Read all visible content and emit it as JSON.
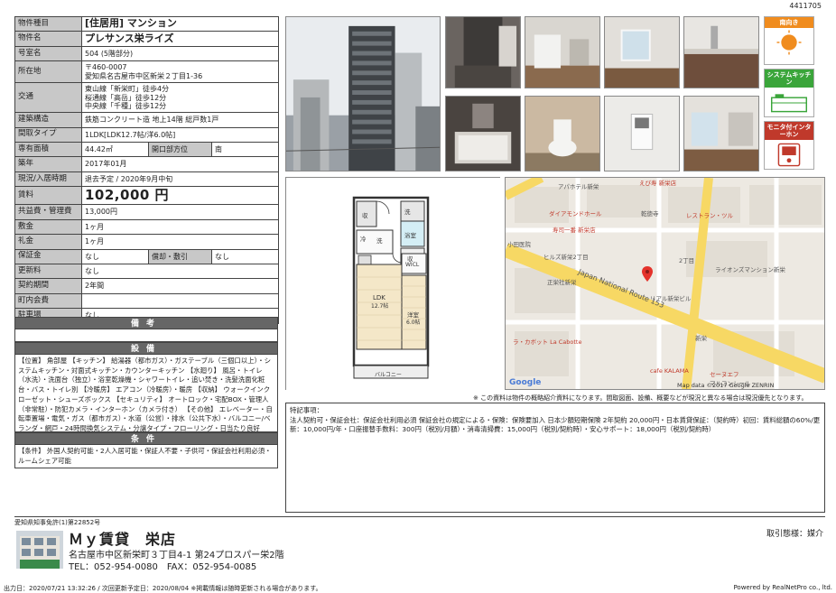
{
  "listing_id": "4411705",
  "spec": {
    "rows": [
      {
        "label": "物件種目",
        "value": "[住居用] マンション",
        "big": true
      },
      {
        "label": "物件名",
        "value": "プレサンス栄ライズ",
        "big": true
      },
      {
        "label": "号室名",
        "value": "504 (5階部分)"
      },
      {
        "label": "所在地",
        "lines": [
          "〒460-0007",
          "愛知県名古屋市中区新栄２丁目1-36"
        ]
      },
      {
        "label": "交通",
        "lines": [
          "東山線「新栄町」徒歩4分",
          "桜通線「高岳」徒歩12分",
          "中央線「千種」徒歩12分"
        ]
      },
      {
        "label": "建築構造",
        "value": "鉄筋コンクリート造 地上14階 総戸数1戸"
      },
      {
        "label": "間取タイプ",
        "value": "1LDK[LDK12.7帖/洋6.0帖]"
      },
      {
        "label": "専有面積",
        "value": "44.42㎡",
        "sub_label": "開口部方位",
        "sub_value": "南"
      },
      {
        "label": "築年",
        "value": "2017年01月"
      },
      {
        "label": "現況/入居時期",
        "value": "退去予定 / 2020年9月中旬"
      },
      {
        "label": "賃料",
        "value": "102,000 円",
        "rent": true
      },
      {
        "label": "共益費・管理費",
        "value": "13,000円"
      },
      {
        "label": "敷金",
        "value": "1ヶ月"
      },
      {
        "label": "礼金",
        "value": "1ヶ月"
      },
      {
        "label": "保証金",
        "value": "なし",
        "sub_label": "償却・敷引",
        "sub_value": "なし"
      },
      {
        "label": "更新料",
        "value": "なし"
      },
      {
        "label": "契約期間",
        "value": "2年間"
      },
      {
        "label": "町内会費",
        "value": ""
      },
      {
        "label": "駐車場",
        "value": "なし"
      }
    ]
  },
  "sections": {
    "biko_title": "備考",
    "biko_text": "",
    "setsubi_title": "設備",
    "setsubi_text": "【位置】 角部屋 【キッチン】 給湯器（都市ガス）・ガステーブル（三個口以上）・システムキッチン・対面式キッチン・カウンターキッチン 【水廻り】 風呂・トイレ（水洗）・洗面台（独立）・浴室乾燥機・シャワートイレ・追い焚き・洗髪洗面化粧台・バス・トイレ別 【冷暖房】 エアコン（冷暖房）・暖房 【収納】 ウォークインクローゼット・シューズボックス 【セキュリティ】 オートロック・宅配BOX・管理人（非常駐）・防犯カメラ・インターホン（カメラ付き） 【その他】 エレベーター・自転車置場・電気・ガス（都市ガス）・水道（公営）・排水（公共下水）・バルコニー/ベランダ・網戸・24時間換気システム・分譲タイプ・フローリング・日当たり良好",
    "joken_title": "条件",
    "joken_text": "【条件】 外国人契約可能・2人入居可能・保証人不要・子供可・保証会社利用必須・ルームシェア可能"
  },
  "badges": [
    {
      "label": "南向き",
      "color": "#f08c1e"
    },
    {
      "label": "システムキッチン",
      "color": "#3aa53a"
    },
    {
      "label": "モニタ付インターホン",
      "color": "#c0392b"
    }
  ],
  "floorplan": {
    "ldk": "LDK",
    "ldk_size": "12.7帖",
    "western": "洋室",
    "western_size": "6.0帖",
    "wicl": "WICL",
    "balcony": "バルコニー",
    "wash": "洗",
    "fridge": "冷",
    "storage": "収",
    "storage2": "収",
    "closet": "洗",
    "bath_label": "浴室"
  },
  "map": {
    "route": "Japan National Route 153",
    "labels": [
      {
        "text": "アパホテル新栄",
        "color": "#555"
      },
      {
        "text": "えび寿 新栄店",
        "color": "#c0392b"
      },
      {
        "text": "ダイアモンドホール",
        "color": "#c0392b"
      },
      {
        "text": "乾徳寺",
        "color": "#555"
      },
      {
        "text": "レストラン・ツル",
        "color": "#c0392b"
      },
      {
        "text": "寿司一番 新栄店",
        "color": "#c0392b"
      },
      {
        "text": "ヒルズ新栄2丁目",
        "color": "#555"
      },
      {
        "text": "2丁目",
        "color": "#555"
      },
      {
        "text": "ライオンズマンション新栄",
        "color": "#555"
      },
      {
        "text": "リアル新栄ビル",
        "color": "#555"
      },
      {
        "text": "新栄",
        "color": "#555"
      },
      {
        "text": "ラ・カボット La Cabotte",
        "color": "#c0392b"
      },
      {
        "text": "cafe KALAMA",
        "color": "#c0392b"
      },
      {
        "text": "セーヌエフ",
        "color": "#c0392b"
      },
      {
        "text": "マルコンシール",
        "color": "#555"
      },
      {
        "text": "小田医院",
        "color": "#555"
      },
      {
        "text": "正栄社新栄",
        "color": "#555"
      },
      {
        "text": "Google",
        "color": "#4a7bd6"
      },
      {
        "text": "Map data ©2017 Google ZENRIN",
        "color": "#333"
      }
    ]
  },
  "notes": {
    "disclaimer": "※ この資料は物件の概略紹介資料になります。間取図面、設備、概要などが現況と異なる場合は現況優先となります。",
    "features_title": "特記事項：",
    "features_text": "法人契約可・保証会社：保証会社利用必須 保証会社の規定による・保険：保険要加入 日本少額短期保険 2年契約 20,000円・日本賃貸保証：（契約時）初回：賃料総額の60%/更新：10,000円/年・口座振替手数料：300円（税別/月額）・消毒清掃費：15,000円（税別/契約時）・安心サポート：18,000円（税別/契約時）"
  },
  "company": {
    "license": "愛知県知事免許(1)第22852号",
    "name": "Ｍｙ賃貸　栄店",
    "address": "名古屋市中区新栄町３丁目4-1 第24プロスパー栄2階",
    "phone": "TEL：052-954-0080　FAX：052-954-0085",
    "deal_type": "取引態様：媒介"
  },
  "footer": {
    "left": "出力日：2020/07/21 13:32:26 / 次回更新予定日：2020/08/04 ※掲載情報は随時更新される場合があります。",
    "right": "Powered by RealNetPro co., ltd."
  }
}
